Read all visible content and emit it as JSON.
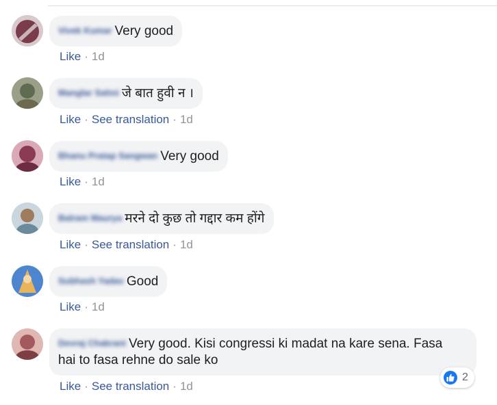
{
  "comments": [
    {
      "author": "Vivek Kumar",
      "text": "Very good",
      "like_label": "Like",
      "time": "1d",
      "avatar_color": "#7a3b4a"
    },
    {
      "author": "Manglar Sahni",
      "text": "जे बात हुवी न ।",
      "like_label": "Like",
      "translate_label": "See translation",
      "time": "1d",
      "avatar_color": "#5f6b4e"
    },
    {
      "author": "Bhanu Pratap Sangwan",
      "text": "Very good",
      "like_label": "Like",
      "time": "1d",
      "avatar_color": "#8a3a52"
    },
    {
      "author": "Balram Maurya",
      "text": "मरने दो कुछ तो गद्दार कम होंगे",
      "like_label": "Like",
      "translate_label": "See translation",
      "time": "1d",
      "avatar_color": "#6b8a9c"
    },
    {
      "author": "Subhash Yadav",
      "text": "Good",
      "like_label": "Like",
      "time": "1d",
      "avatar_color": "#3f6fb0"
    },
    {
      "author": "Devraj Chakrani",
      "text": "Very good. Kisi congressi ki madat na kare sena. Fasa hai to fasa rehne do sale ko",
      "like_label": "Like",
      "translate_label": "See translation",
      "time": "1d",
      "avatar_color": "#a35a5e",
      "reaction_count": "2"
    }
  ],
  "separator": "·",
  "colors": {
    "link": "#385898",
    "bubble": "#f2f3f5",
    "like_badge": "#1877f2"
  }
}
